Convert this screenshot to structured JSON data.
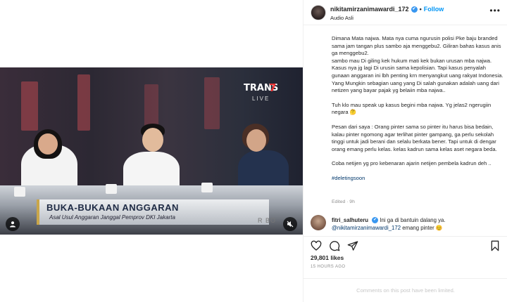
{
  "video": {
    "channel_logo": "TRANS",
    "channel_number": "7",
    "live_label": "LIVE",
    "lower_third_title": "BUKA-BUKAAN ANGGARAN",
    "lower_third_subtitle": "Asal Usul Anggaran Janggal Pemprov DKI Jakarta",
    "lower_third_right": "R BO",
    "controls": {
      "left_icon": "user-tag-icon",
      "right_icon": "mute-icon"
    }
  },
  "post": {
    "username": "nikitamirzanimawardi_172",
    "follow_label": "Follow",
    "separator": "•",
    "audio_label": "Audio Asli",
    "more_label": "•••",
    "caption_paragraphs": [
      "Dimana Mata najwa. Mata nya cuma ngurusin polisi Pke baju branded sama jam tangan plus sambo aja menggebu2. Giliran bahas kasus anis ga menggebu2.\nsambo mau Di giling kek hukum mati kek bukan urusan mba najwa. Kasus nya jg lagi Di urusin sama kepolisian. Tapi kasus penyalah gunaan anggaran ini lbh penting krn menyangkut uang rakyat Indonesia. Yang Mungkin sebagian uang yang Di salah gunakan adalah uang dari netizen yang bayar pajak yg belaiin mba najwa..",
      "Tuh klo mau speak up kasus begini mba najwa. Yg jelas2 ngerugiin negara 🤔",
      "Pesan dari saya : Orang pinter sama so pinter itu harus bisa bedain, kalau pinter ngomong agar terlihat pinter gampang, ga perlu sekolah tinggi untuk jadi berani dan selalu berkata bener. Tapi untuk di dengar orang emang perlu kelas. kelas kadrun sama kelas aset negara beda.",
      "Coba netijen yg pro kebenaran ajarin netijen pembela kadrun deh .."
    ],
    "hashtag": "#deletingsoon",
    "edited_label": "Edited · 9h",
    "comment": {
      "username": "fitri_salhuteru",
      "verified": "✔",
      "text": "Ini ga di bantuin dalang ya.",
      "mention": "@nikitamirzanimawardi_172",
      "reply": "emang pinter 😊"
    },
    "likes": "29,801 likes",
    "timestamp": "15 HOURS AGO",
    "comments_limited": "Comments on this post have been limited."
  },
  "icons": [
    "heart-icon",
    "comment-icon",
    "share-icon",
    "bookmark-icon",
    "verified-icon"
  ],
  "colors": {
    "link": "#0095f6",
    "tag": "#00376b",
    "muted": "#8e8e8e",
    "verified": "#3897f0"
  }
}
